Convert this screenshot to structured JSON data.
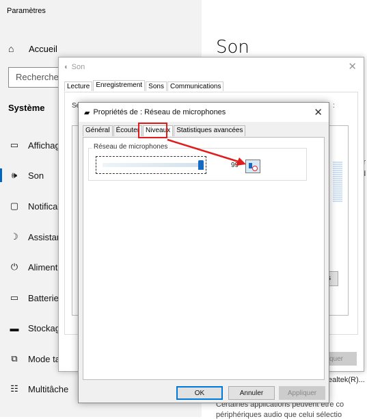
{
  "settings": {
    "window_title": "Paramètres",
    "home_label": "Accueil",
    "search_placeholder": "Recherchez",
    "section_label": "Système",
    "nav": [
      {
        "label": "Affichage",
        "icon": "monitor-icon"
      },
      {
        "label": "Son",
        "icon": "speaker-icon"
      },
      {
        "label": "Notifica",
        "icon": "notification-icon"
      },
      {
        "label": "Assistan",
        "icon": "moon-icon"
      },
      {
        "label": "Aliment",
        "icon": "power-icon"
      },
      {
        "label": "Batterie",
        "icon": "battery-icon"
      },
      {
        "label": "Stockag",
        "icon": "storage-icon"
      },
      {
        "label": "Mode ta",
        "icon": "tablet-icon"
      },
      {
        "label": "Multitâche",
        "icon": "multitask-icon"
      }
    ],
    "page_title": "Son",
    "right_text_1": "i",
    "right_text_2": "ir",
    "right_text_3": "d",
    "device_text": "ealtek(R)...",
    "footer_text_1": "Certaines applications peuvent être co",
    "footer_text_2": "périphériques audio que celui sélectio"
  },
  "son_dialog": {
    "title": "Son",
    "tabs": [
      "Lecture",
      "Enregistrement",
      "Sons",
      "Communications"
    ],
    "active_tab": "Enregistrement",
    "description": "Sé",
    "description_end": ":",
    "properties_button": "tés",
    "apply_button": "pliquer"
  },
  "props_dialog": {
    "title": "Propriétés de : Réseau de microphones",
    "tabs": [
      "Général",
      "Écouter",
      "Niveaux",
      "Statistiques avancées"
    ],
    "active_tab": "Niveaux",
    "group_label": "Réseau de microphones",
    "level_value": "99",
    "level_percent": 99,
    "ok_button": "OK",
    "cancel_button": "Annuler",
    "apply_button": "Appliquer"
  },
  "colors": {
    "accent": "#0067c0",
    "highlight": "#e01d1d",
    "slider": "#1769c4"
  }
}
